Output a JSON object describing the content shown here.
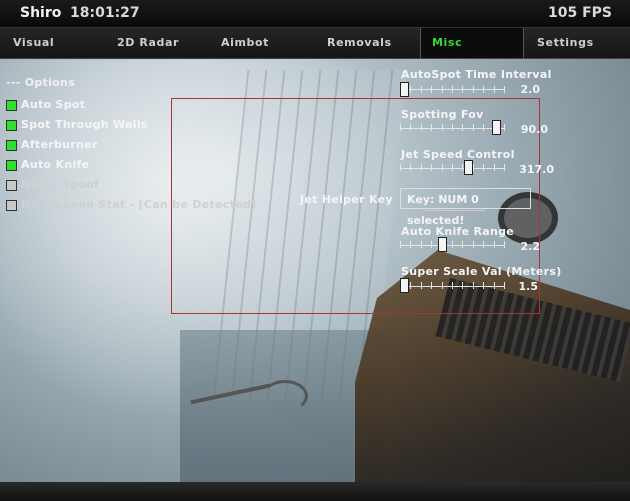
{
  "header": {
    "app_name": "Shiro",
    "time": "18:01:27",
    "fps": "105 FPS"
  },
  "tabs": [
    {
      "label": "Visual",
      "active": false
    },
    {
      "label": "2D Radar",
      "active": false
    },
    {
      "label": "Aimbot",
      "active": false
    },
    {
      "label": "Removals",
      "active": false
    },
    {
      "label": "Misc",
      "active": true
    },
    {
      "label": "Settings",
      "active": false
    }
  ],
  "options": {
    "header": "--- Options",
    "items": [
      {
        "label": "Auto Spot",
        "enabled": true
      },
      {
        "label": "Spot Through Walls",
        "enabled": true
      },
      {
        "label": "Afterburner",
        "enabled": true
      },
      {
        "label": "Auto Knife",
        "enabled": true
      },
      {
        "label": "Name Spoof",
        "enabled": false
      },
      {
        "label": "No Weapon Stat - [Can be Detected]",
        "enabled": false
      }
    ]
  },
  "sliders": [
    {
      "label": "AutoSpot Time Interval",
      "value": "2.0",
      "fraction": 0.0
    },
    {
      "label": "Spotting Fov",
      "value": "90.0",
      "fraction": 0.97
    },
    {
      "label": "Jet Speed Control",
      "value": "317.0",
      "fraction": 0.67
    },
    {
      "label": "Auto Knife Range",
      "value": "2.2",
      "fraction": 0.4
    },
    {
      "label": "Super Scale Val (Meters)",
      "value": "1.5",
      "fraction": 0.0
    }
  ],
  "jet_helper": {
    "label": "Jet Helper Key",
    "value": "Key: NUM 0 selected!"
  },
  "colors": {
    "active_tab": "#37d737",
    "checkbox_on": "#2ee02e",
    "checkbox_off": "#c8c8c8",
    "frame": "#aa3333"
  }
}
